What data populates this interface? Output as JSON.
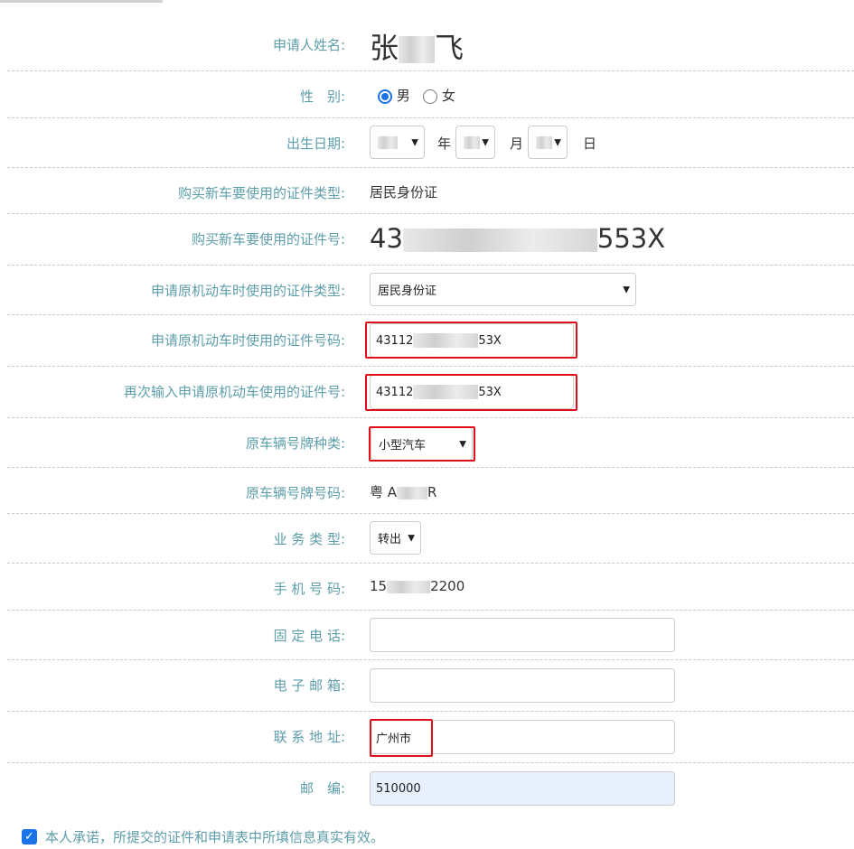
{
  "form": {
    "applicant_name": {
      "label": "申请人姓名:",
      "first": "张",
      "last": "飞"
    },
    "gender": {
      "label": "性　别:",
      "options": [
        "男",
        "女"
      ],
      "selected": "男"
    },
    "birth": {
      "label": "出生日期:",
      "year_unit": "年",
      "month_unit": "月",
      "day_unit": "日"
    },
    "new_id_type": {
      "label": "购买新车要使用的证件类型:",
      "value": "居民身份证"
    },
    "new_id_no": {
      "label": "购买新车要使用的证件号:",
      "prefix": "43",
      "suffix": "553X"
    },
    "orig_id_type": {
      "label": "申请原机动车时使用的证件类型:",
      "value": "居民身份证"
    },
    "orig_id_no": {
      "label": "申请原机动车时使用的证件号码:",
      "prefix": "43112",
      "suffix": "53X"
    },
    "orig_id_no_confirm": {
      "label": "再次输入申请原机动车使用的证件号:",
      "prefix": "43112",
      "suffix": "53X"
    },
    "plate_type": {
      "label": "原车辆号牌种类:",
      "value": "小型汽车"
    },
    "plate_no": {
      "label": "原车辆号牌号码:",
      "prefix": "粤 A",
      "suffix": "R"
    },
    "business_type": {
      "label": "业 务 类 型:",
      "value": "转出"
    },
    "mobile": {
      "label": "手 机 号 码:",
      "prefix": "15",
      "suffix": "2200"
    },
    "landline": {
      "label": "固 定 电 话:",
      "value": ""
    },
    "email": {
      "label": "电 子 邮 箱:",
      "value": ""
    },
    "address": {
      "label": "联 系 地 址:",
      "value": "广州市"
    },
    "postcode": {
      "label": "邮　编:",
      "value": "510000"
    }
  },
  "agreement": {
    "text": "本人承诺，所提交的证件和申请表中所填信息真实有效。",
    "checked": true
  },
  "colors": {
    "label": "#5d9eaa",
    "highlight": "#e0101a",
    "autofill": "#e8f0fe",
    "checkbox": "#1a73e8"
  }
}
